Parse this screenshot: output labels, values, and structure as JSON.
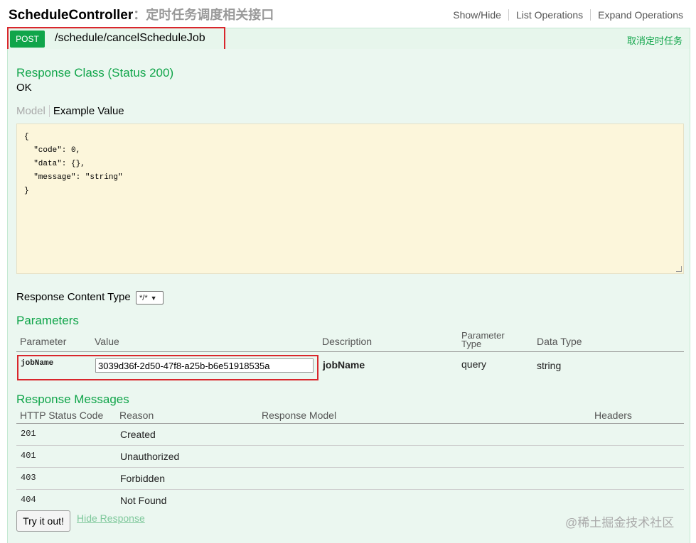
{
  "header": {
    "controller_name": "ScheduleController",
    "controller_desc": "：定时任务调度相关接口",
    "links": [
      "Show/Hide",
      "List Operations",
      "Expand Operations"
    ]
  },
  "operation": {
    "method": "POST",
    "path": "/schedule/cancelScheduleJob",
    "summary": "取消定时任务"
  },
  "response_class": {
    "heading": "Response Class (Status 200)",
    "text": "OK",
    "tab_model": "Model",
    "tab_example": "Example Value",
    "sample_lines": [
      "{",
      "  \"code\": 0,",
      "  \"data\": {},",
      "  \"message\": \"string\"",
      "}"
    ]
  },
  "content_type": {
    "label": "Response Content Type",
    "selected": "*/*"
  },
  "parameters": {
    "heading": "Parameters",
    "columns": [
      "Parameter",
      "Value",
      "Description",
      "Parameter Type",
      "Data Type"
    ],
    "rows": [
      {
        "name": "jobName",
        "value": "3039d36f-2d50-47f8-a25b-b6e51918535a",
        "description": "jobName",
        "type": "query",
        "data_type": "string"
      }
    ]
  },
  "responses": {
    "heading": "Response Messages",
    "columns": [
      "HTTP Status Code",
      "Reason",
      "Response Model",
      "Headers"
    ],
    "rows": [
      {
        "code": "201",
        "reason": "Created"
      },
      {
        "code": "401",
        "reason": "Unauthorized"
      },
      {
        "code": "403",
        "reason": "Forbidden"
      },
      {
        "code": "404",
        "reason": "Not Found"
      }
    ]
  },
  "actions": {
    "try_label": "Try it out!",
    "hide_label": "Hide Response"
  },
  "watermark": "@稀土掘金技术社区",
  "colors": {
    "accent": "#10a54a",
    "highlight_box": "#d9262c",
    "sample_bg": "#fcf6db"
  }
}
